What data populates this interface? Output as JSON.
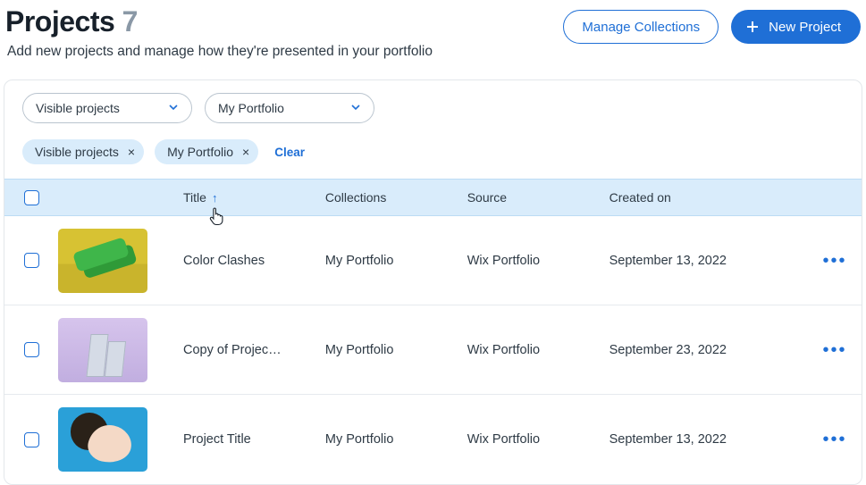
{
  "header": {
    "title_prefix": "Projects",
    "count": "7",
    "subtitle": "Add new projects and manage how they're presented in your portfolio",
    "manage_label": "Manage Collections",
    "new_label": "New Project"
  },
  "filters": {
    "select1": "Visible projects",
    "select2": "My Portfolio",
    "chip1": "Visible projects",
    "chip2": "My Portfolio",
    "clear": "Clear"
  },
  "columns": {
    "title": "Title",
    "collections": "Collections",
    "source": "Source",
    "created": "Created on"
  },
  "rows": [
    {
      "title": "Color Clashes",
      "collections": "My Portfolio",
      "source": "Wix Portfolio",
      "created": "September 13, 2022"
    },
    {
      "title": "Copy of Projec…",
      "collections": "My Portfolio",
      "source": "Wix Portfolio",
      "created": "September 23, 2022"
    },
    {
      "title": "Project Title",
      "collections": "My Portfolio",
      "source": "Wix Portfolio",
      "created": "September 13, 2022"
    }
  ]
}
